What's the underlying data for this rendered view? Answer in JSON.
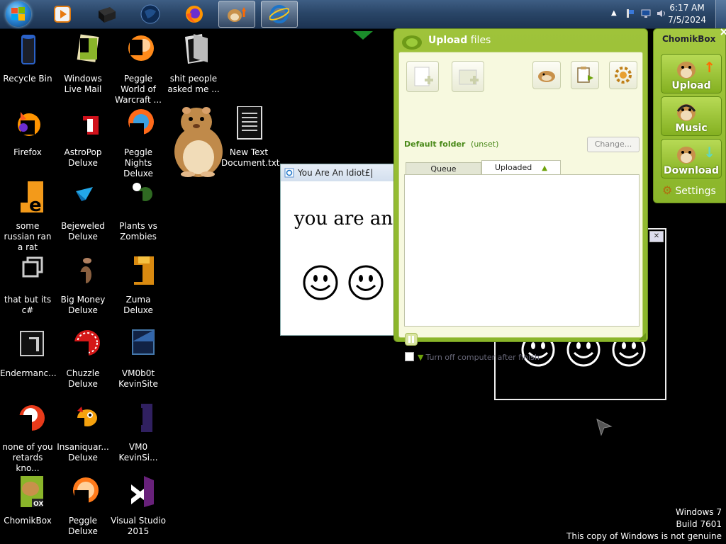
{
  "taskbar": {
    "clock": {
      "time": "6:17 AM",
      "date": "7/5/2024"
    },
    "buttons": [
      {
        "name": "start-orb"
      },
      {
        "name": "media-player",
        "active": false
      },
      {
        "name": "black-app",
        "active": false
      },
      {
        "name": "globe-app",
        "active": false
      },
      {
        "name": "firefox",
        "active": false
      },
      {
        "name": "chomikbox",
        "active": true
      },
      {
        "name": "internet-explorer",
        "active": true
      }
    ]
  },
  "desktop": {
    "icons": [
      {
        "label": "Recycle Bin",
        "icon": "recycle-bin-icon"
      },
      {
        "label": "Windows Live Mail",
        "icon": "mail-icon"
      },
      {
        "label": "Peggle World of Warcraft ...",
        "icon": "peggle-icon"
      },
      {
        "label": "shit people asked me ...",
        "icon": "folder-icon"
      },
      {
        "label": "Firefox",
        "icon": "firefox-icon"
      },
      {
        "label": "AstroPop Deluxe",
        "icon": "astropop-icon"
      },
      {
        "label": "Peggle Nights Deluxe",
        "icon": "peggle-nights-icon"
      },
      {
        "label": "New Text Document.txt",
        "icon": "text-document-icon"
      },
      {
        "label": "some russian ran a rat",
        "icon": "orange-e-icon"
      },
      {
        "label": "Bejeweled Deluxe",
        "icon": "bejeweled-icon"
      },
      {
        "label": "Plants vs Zombies",
        "icon": "plants-vs-zombies-icon"
      },
      {
        "label": "that but its c#",
        "icon": "windows-stack-icon"
      },
      {
        "label": "Big Money Deluxe",
        "icon": "big-money-icon"
      },
      {
        "label": "Zuma Deluxe",
        "icon": "zuma-icon"
      },
      {
        "label": "Endermanc...",
        "icon": "dark-window-icon"
      },
      {
        "label": "Chuzzle Deluxe",
        "icon": "chuzzle-icon"
      },
      {
        "label": "VM0b0t KevinSite",
        "icon": "vm-icon"
      },
      {
        "label": "none of you retards kno...",
        "icon": "red-ball-icon"
      },
      {
        "label": "Insaniquar... Deluxe",
        "icon": "insaniquarium-icon"
      },
      {
        "label": "VM0 KevinSi...",
        "icon": "vm2-icon"
      },
      {
        "label": "ChomikBox",
        "icon": "chomikbox-icon"
      },
      {
        "label": "Peggle Deluxe",
        "icon": "peggle-deluxe-icon"
      },
      {
        "label": "Visual Studio 2015",
        "icon": "visual-studio-icon"
      }
    ]
  },
  "idiot_window": {
    "title": "You Are An Idiot£|",
    "text": "you are an i"
  },
  "upload_window": {
    "title_bold": "Upload",
    "title_rest": " files",
    "default_folder_label": "Default folder",
    "default_folder_value": "(unset)",
    "change_button": "Change...",
    "tabs": [
      {
        "label": "Queue",
        "selected": false
      },
      {
        "label": "Uploaded",
        "selected": true
      }
    ],
    "turn_off_label": "Turn off computer after finish",
    "turn_off_checked": false
  },
  "side_panel": {
    "title": "ChomikBox",
    "buttons": [
      "Upload",
      "Music",
      "Download"
    ],
    "settings_label": "Settings"
  },
  "watermark": {
    "line1": "Windows 7",
    "line2": "Build 7601",
    "line3": "This copy of Windows is not genuine"
  },
  "colors": {
    "chomik_green": "#8ab52a",
    "taskbar": "#2a4668",
    "desktop": "#000000"
  }
}
